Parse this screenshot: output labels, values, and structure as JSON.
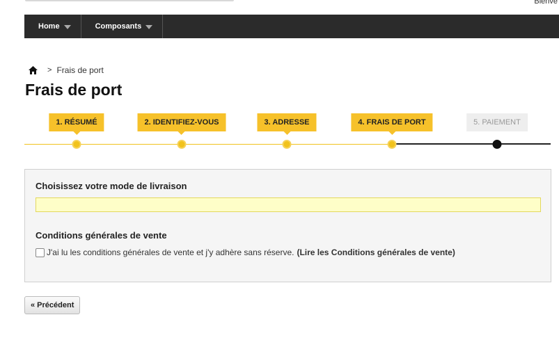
{
  "header": {
    "welcome": "Bienve"
  },
  "nav": {
    "items": [
      {
        "label": "Home"
      },
      {
        "label": "Composants"
      }
    ]
  },
  "breadcrumb": {
    "separator": ">",
    "current": "Frais de port"
  },
  "page": {
    "title": "Frais de port"
  },
  "steps": [
    {
      "label": "1. RÉSUMÉ",
      "state": "done"
    },
    {
      "label": "2. IDENTIFIEZ-VOUS",
      "state": "done"
    },
    {
      "label": "3. ADRESSE",
      "state": "done"
    },
    {
      "label": "4. FRAIS DE PORT",
      "state": "current"
    },
    {
      "label": "5. PAIEMENT",
      "state": "upcoming"
    }
  ],
  "shipping": {
    "heading": "Choisissez votre mode de livraison"
  },
  "cgv": {
    "heading": "Conditions générales de vente",
    "text": "J'ai lu les conditions générales de vente et j'y adhère sans réserve.",
    "link": "(Lire les Conditions générales de vente)",
    "checked": false
  },
  "actions": {
    "previous": "« Précédent"
  },
  "colors": {
    "accent": "#f6c12a",
    "navbar": "#2b2b2b",
    "panel": "#f5f5f5",
    "ship_box": "#fefec8"
  },
  "icons": {
    "home": "home-icon",
    "nav_caret": "caret-down-icon"
  }
}
